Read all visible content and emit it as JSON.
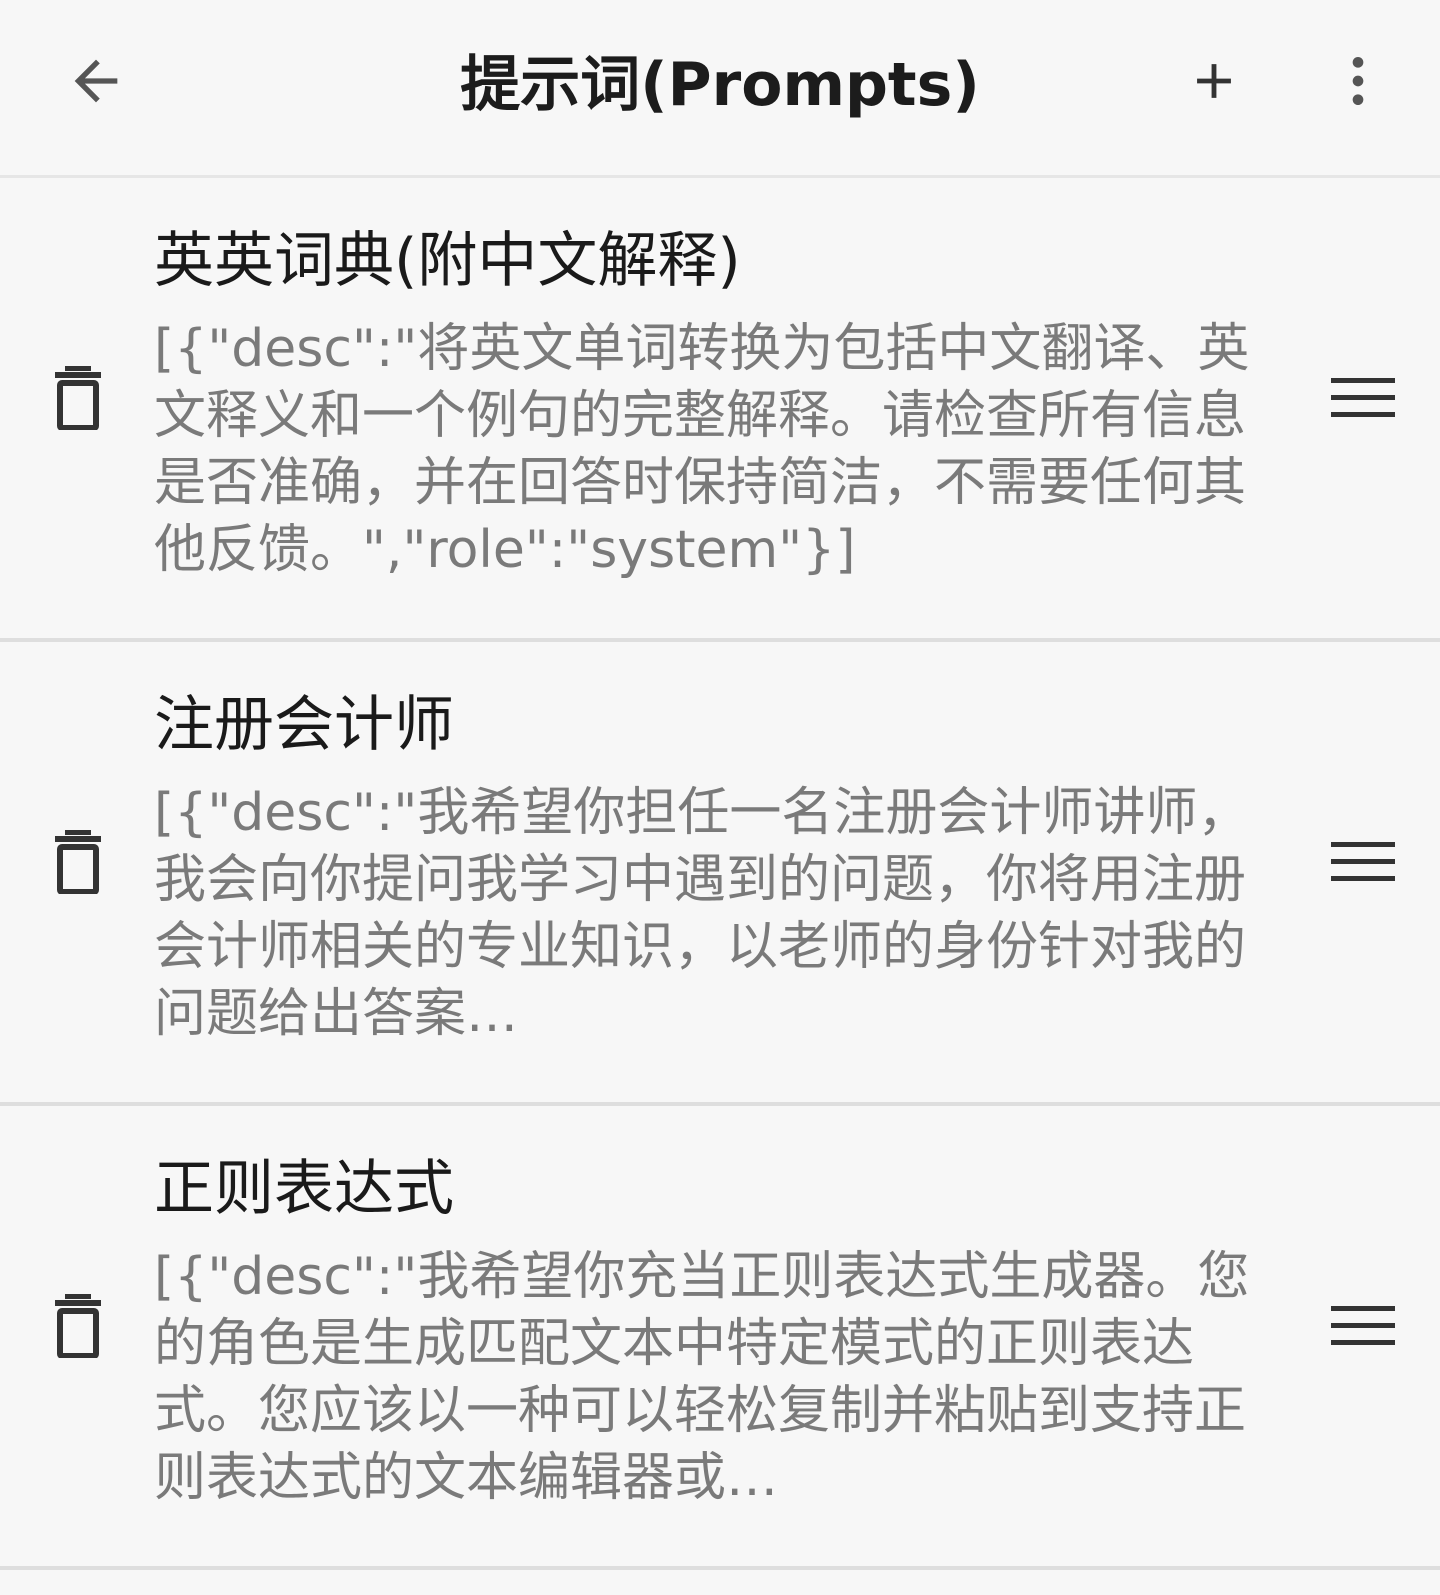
{
  "toolbar": {
    "title": "提示词(Prompts)",
    "back_icon": "arrow-left-icon",
    "add_icon": "plus-icon",
    "more_icon": "more-vert-icon"
  },
  "prompts": [
    {
      "title": "英英词典(附中文解释)",
      "desc": "[{\"desc\":\"将英文单词转换为包括中文翻译、英文释义和一个例句的完整解释。请检查所有信息是否准确，并在回答时保持简洁，不需要任何其他反馈。\",\"role\":\"system\"}]"
    },
    {
      "title": "注册会计师",
      "desc": "[{\"desc\":\"我希望你担任一名注册会计师讲师，我会向你提问我学习中遇到的问题，你将用注册会计师相关的专业知识，以老师的身份针对我的问题给出答案…"
    },
    {
      "title": "正则表达式",
      "desc": "[{\"desc\":\"我希望你充当正则表达式生成器。您的角色是生成匹配文本中特定模式的正则表达式。您应该以一种可以轻松复制并粘贴到支持正则表达式的文本编辑器或…"
    }
  ],
  "item_icons": {
    "delete": "trash-icon",
    "drag": "drag-handle-icon"
  }
}
